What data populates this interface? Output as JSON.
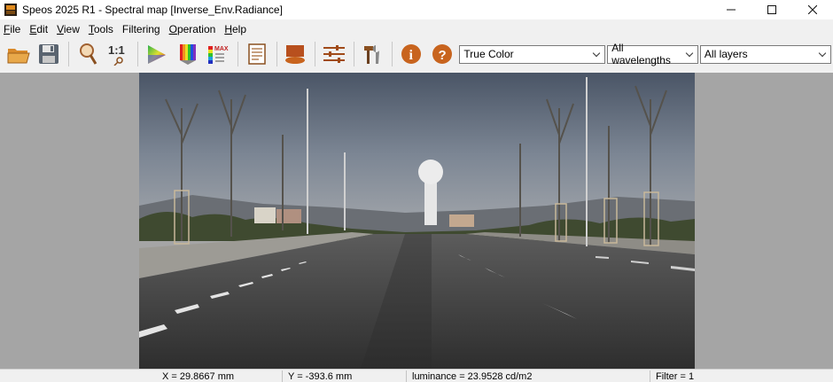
{
  "window": {
    "title": "Speos 2025 R1 - Spectral map [Inverse_Env.Radiance]",
    "controls": {
      "minimize": "—",
      "maximize": "☐",
      "close": "✕"
    }
  },
  "menu": {
    "items": [
      {
        "id": "file",
        "label": "File",
        "accel": "F",
        "rest": "ile"
      },
      {
        "id": "edit",
        "label": "Edit",
        "accel": "E",
        "rest": "dit"
      },
      {
        "id": "view",
        "label": "View",
        "accel": "V",
        "rest": "iew"
      },
      {
        "id": "tools",
        "label": "Tools",
        "accel": "T",
        "rest": "ools"
      },
      {
        "id": "filtering",
        "label": "Filtering",
        "accel": "F",
        "rest": "iltering"
      },
      {
        "id": "operation",
        "label": "Operation",
        "accel": "O",
        "rest": "peration"
      },
      {
        "id": "help",
        "label": "Help",
        "accel": "H",
        "rest": "elp"
      }
    ]
  },
  "toolbar": {
    "buttons": [
      {
        "id": "open",
        "icon": "folder-open-icon"
      },
      {
        "id": "save",
        "icon": "floppy-disk-icon"
      },
      {
        "id": "zoom",
        "icon": "magnifier-icon"
      },
      {
        "id": "zoom-1-1",
        "icon": "zoom-1-1-icon",
        "text": "1:1"
      },
      {
        "id": "color-space",
        "icon": "color-triangle-icon"
      },
      {
        "id": "spectrum",
        "icon": "rainbow-prism-icon"
      },
      {
        "id": "scale-max",
        "icon": "color-scale-max-icon",
        "text": "MAX"
      },
      {
        "id": "report",
        "icon": "document-report-icon"
      },
      {
        "id": "surface",
        "icon": "surface-view-icon"
      },
      {
        "id": "settings",
        "icon": "sliders-icon"
      },
      {
        "id": "tools",
        "icon": "hammer-wrench-icon"
      },
      {
        "id": "info",
        "icon": "info-icon",
        "text": "i"
      },
      {
        "id": "help",
        "icon": "help-icon",
        "text": "?"
      }
    ],
    "color_mode": "True Color",
    "wavelengths": "All wavelengths",
    "layers": "All layers"
  },
  "status": {
    "x": "X = 29.8667 mm",
    "y": "Y = -393.6 mm",
    "luminance": "luminance = 23.9528 cd/m2",
    "filter": "Filter = 1"
  },
  "colors": {
    "background_gray": "#a5a5a5",
    "icon_orange": "#c8641e",
    "icon_brown": "#a04a18"
  }
}
